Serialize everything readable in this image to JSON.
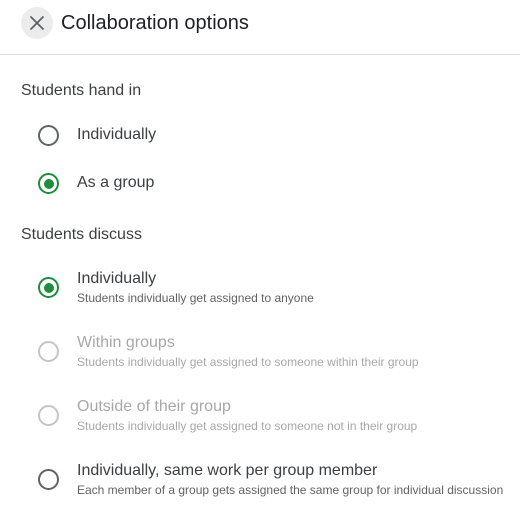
{
  "header": {
    "title": "Collaboration options",
    "close_icon": "close-icon"
  },
  "hand_in": {
    "label": "Students hand in",
    "options": [
      {
        "label": "Individually",
        "checked": false,
        "disabled": false
      },
      {
        "label": "As a group",
        "checked": true,
        "disabled": false
      }
    ]
  },
  "discuss": {
    "label": "Students discuss",
    "options": [
      {
        "label": "Individually",
        "description": "Students individually get assigned to anyone",
        "checked": true,
        "disabled": false
      },
      {
        "label": "Within groups",
        "description": "Students individually get assigned to someone within their group",
        "checked": false,
        "disabled": true
      },
      {
        "label": "Outside of their group",
        "description": "Students individually get assigned to someone not in their group",
        "checked": false,
        "disabled": true
      },
      {
        "label": "Individually, same work per group member",
        "description": "Each member of a group gets assigned the same group for individual discussion",
        "checked": false,
        "disabled": false
      }
    ]
  },
  "colors": {
    "accent": "#1e8e3e",
    "text": "#3c4043",
    "disabled": "#a8a8a8"
  }
}
